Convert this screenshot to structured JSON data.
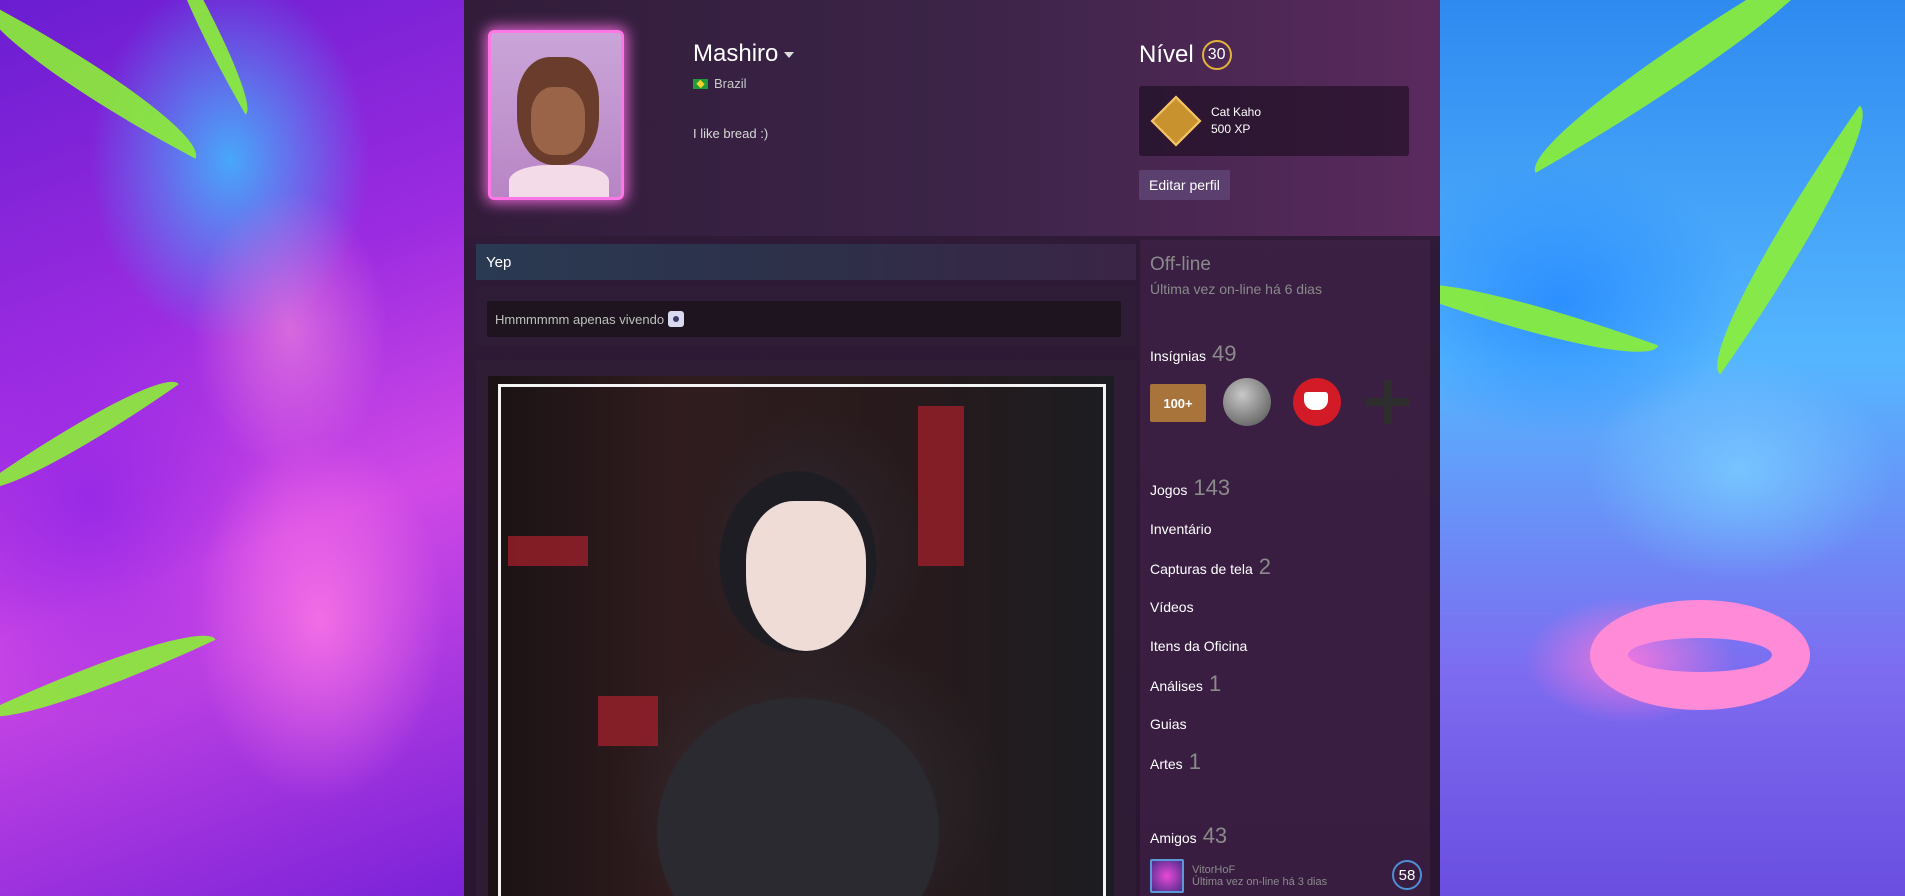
{
  "profile": {
    "persona_name": "Mashiro",
    "location": "Brazil",
    "summary": "I like bread :)"
  },
  "level": {
    "label": "Nível",
    "value": "30"
  },
  "favorite_badge": {
    "name": "Cat Kaho",
    "xp": "500 XP"
  },
  "edit_profile_label": "Editar perfil",
  "showcase_text": {
    "title": "Yep",
    "body": "Hmmmmmm apenas vivendo"
  },
  "status": {
    "state": "Off-line",
    "last_online": "Última vez on-line há 6 dias"
  },
  "sidebar": {
    "badges": {
      "label": "Insígnias",
      "count": "49",
      "first_badge_text": "100+"
    },
    "games": {
      "label": "Jogos",
      "count": "143"
    },
    "inventory": {
      "label": "Inventário"
    },
    "screenshots": {
      "label": "Capturas de tela",
      "count": "2"
    },
    "videos": {
      "label": "Vídeos"
    },
    "workshop": {
      "label": "Itens da Oficina"
    },
    "reviews": {
      "label": "Análises",
      "count": "1"
    },
    "guides": {
      "label": "Guias"
    },
    "artwork": {
      "label": "Artes",
      "count": "1"
    },
    "friends": {
      "label": "Amigos",
      "count": "43"
    }
  },
  "friend": {
    "name": "VitorHoF",
    "status": "Última vez on-line há 3 dias",
    "level": "58"
  },
  "colors": {
    "avatar_frame_glow": "#ff76e6",
    "level_ring": "#e2b23b",
    "friend_level_ring": "#4d8fd6"
  }
}
